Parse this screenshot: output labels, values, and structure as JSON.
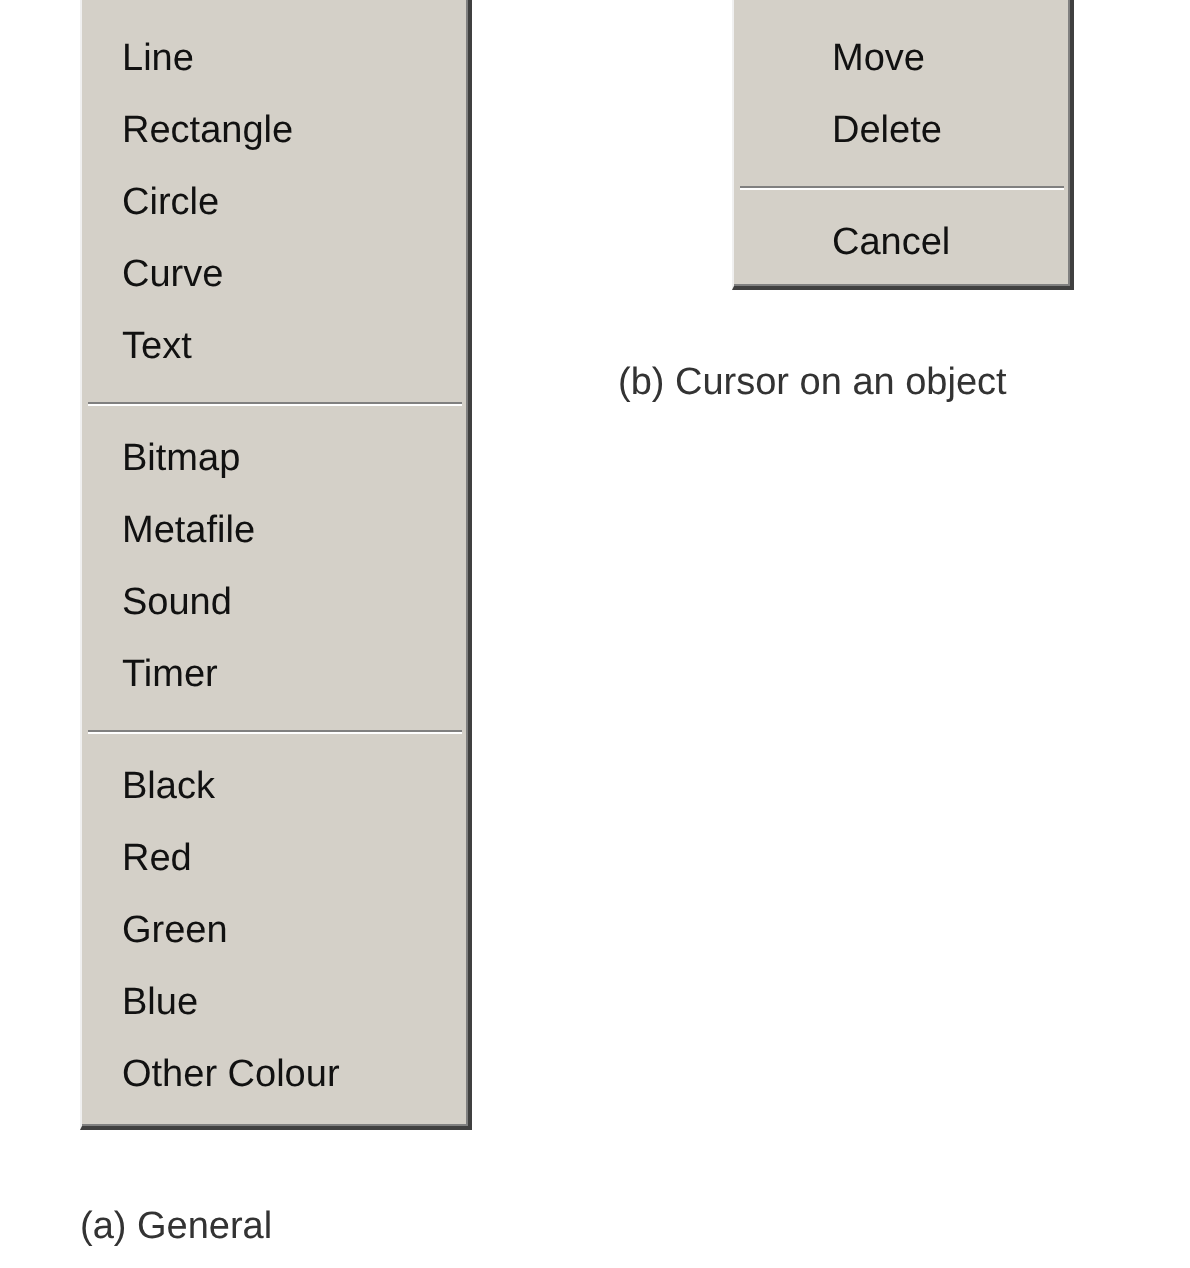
{
  "menus": [
    {
      "caption": "(a) General",
      "groups": [
        {
          "items": [
            "Line",
            "Rectangle",
            "Circle",
            "Curve",
            "Text"
          ]
        },
        {
          "items": [
            "Bitmap",
            "Metafile",
            "Sound",
            "Timer"
          ]
        },
        {
          "items": [
            "Black",
            "Red",
            "Green",
            "Blue",
            "Other Colour"
          ]
        }
      ]
    },
    {
      "caption": "(b) Cursor on an object",
      "groups": [
        {
          "items": [
            "Move",
            "Delete"
          ]
        },
        {
          "items": [
            "Cancel"
          ]
        }
      ]
    }
  ]
}
